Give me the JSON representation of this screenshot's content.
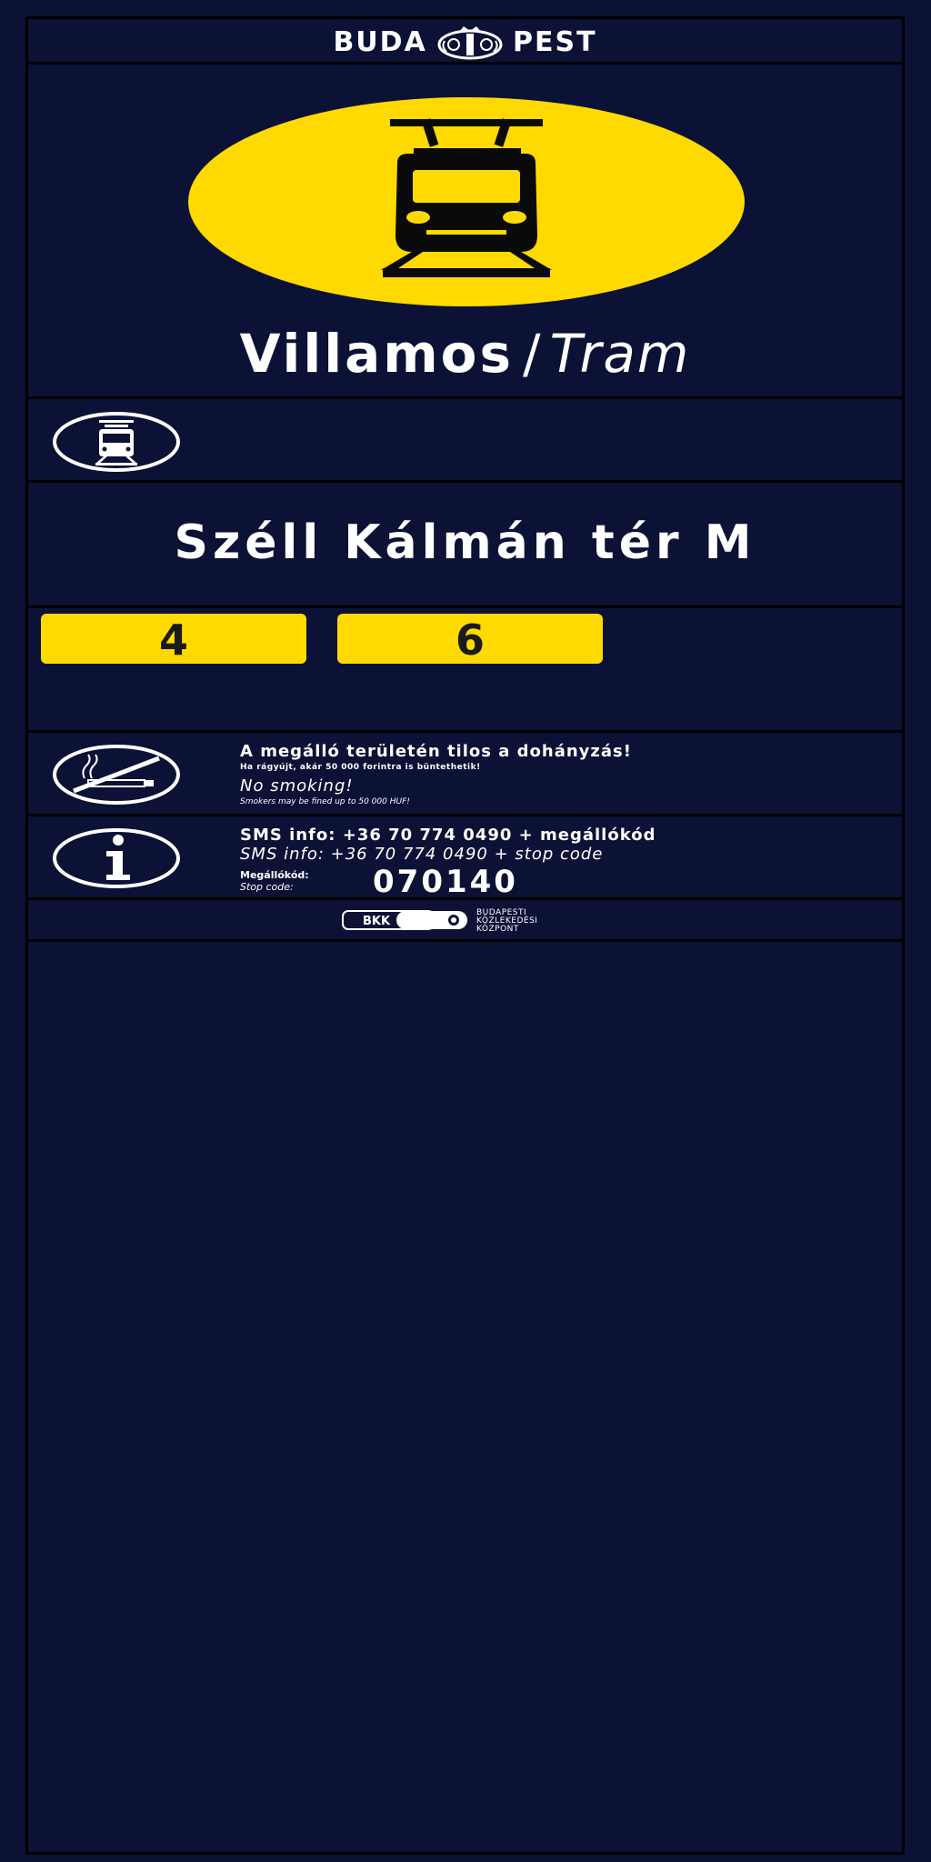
{
  "header": {
    "city_left": "BUDA",
    "city_right": "PEST",
    "crest_icon": "coat-of-arms-icon"
  },
  "hero": {
    "icon": "tram-icon",
    "title_hu": "Villamos",
    "title_sep": "/",
    "title_en": "Tram",
    "accent_color": "#ffda00"
  },
  "icon_row": {
    "icon": "tram-icon"
  },
  "stop": {
    "name": "Széll Kálmán tér M"
  },
  "routes": [
    {
      "number": "4"
    },
    {
      "number": "6"
    }
  ],
  "no_smoking": {
    "icon": "no-smoking-icon",
    "title_hu": "A megálló területén tilos a dohányzás!",
    "sub_hu": "Ha rágyújt, akár 50 000 forintra is büntethetik!",
    "title_en": "No smoking!",
    "sub_en": "Smokers may be fined up to 50 000 HUF!"
  },
  "sms": {
    "icon": "info-icon",
    "line_hu": "SMS info: +36 70 774 0490 + megállókód",
    "line_en": "SMS info: +36 70 774 0490 + stop code",
    "code_label_hu": "Megállókód:",
    "code_label_en": "Stop code:",
    "code": "070140"
  },
  "footer": {
    "logo": "BKK",
    "text_lines": [
      "BUDAPESTI",
      "KÖZLEKEDÉSI",
      "KÖZPONT"
    ]
  },
  "colors": {
    "background": "#0b1235",
    "accent": "#ffda00",
    "divider": "#000000"
  }
}
